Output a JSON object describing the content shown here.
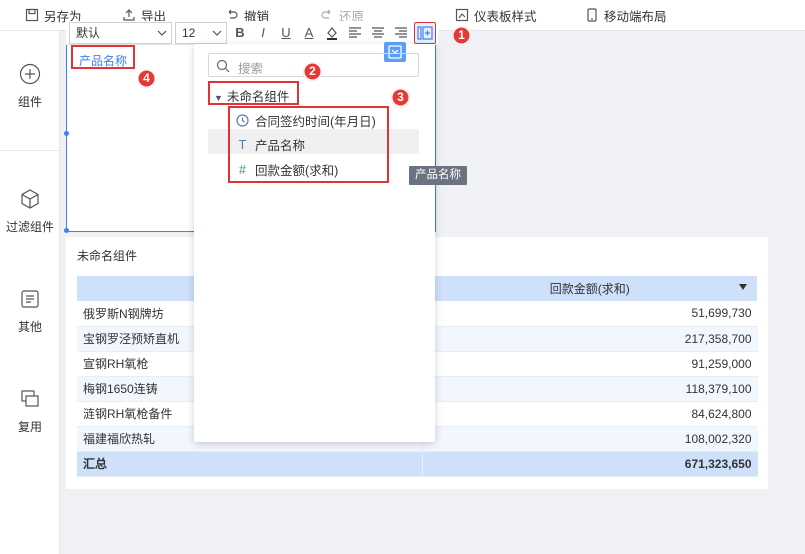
{
  "toolbar": {
    "save_as": "另存为",
    "export": "导出",
    "undo": "撤销",
    "redo": "还原",
    "dashboard_style": "仪表板样式",
    "mobile_layout": "移动端布局"
  },
  "format_bar": {
    "font": "默认",
    "size": "12",
    "bold": "B",
    "italic": "I",
    "underline": "U",
    "font_color": "A"
  },
  "sidebar": {
    "items": [
      {
        "label": "组件",
        "icon": "plus-circle-icon"
      },
      {
        "label": "过滤组件",
        "icon": "cube-icon"
      },
      {
        "label": "其他",
        "icon": "document-icon"
      },
      {
        "label": "复用",
        "icon": "copy-icon"
      }
    ]
  },
  "filter_widget": {
    "field_label": "产品名称"
  },
  "field_panel": {
    "search_placeholder": "搜索",
    "group_name": "未命名组件",
    "fields": [
      {
        "name": "合同签约时间(年月日)",
        "type_icon": "clock-icon"
      },
      {
        "name": "产品名称",
        "type_icon": "text-type-icon",
        "type_glyph": "T"
      },
      {
        "name": "回款金额(求和)",
        "type_icon": "number-type-icon",
        "type_glyph": "#"
      }
    ]
  },
  "tooltip": "产品名称",
  "table": {
    "title": "未命名组件",
    "columns": [
      "",
      "回款金额(求和)"
    ],
    "rows": [
      {
        "name": "俄罗斯N钢牌坊",
        "amount": "51,699,730"
      },
      {
        "name": "宝钢罗泾预矫直机",
        "amount": "217,358,700"
      },
      {
        "name": "宣钢RH氧枪",
        "amount": "91,259,000"
      },
      {
        "name": "梅钢1650连铸",
        "amount": "118,379,100"
      },
      {
        "name": "涟钢RH氧枪备件",
        "amount": "84,624,800"
      },
      {
        "name": "福建福欣热轧",
        "amount": "108,002,320"
      }
    ],
    "total_label": "汇总",
    "total_amount": "671,323,650"
  },
  "annotations": [
    "1",
    "2",
    "3",
    "4"
  ],
  "colors": {
    "accent": "#3d7ff5",
    "annotation_red": "#e53935",
    "table_header": "#cfe0fb"
  }
}
